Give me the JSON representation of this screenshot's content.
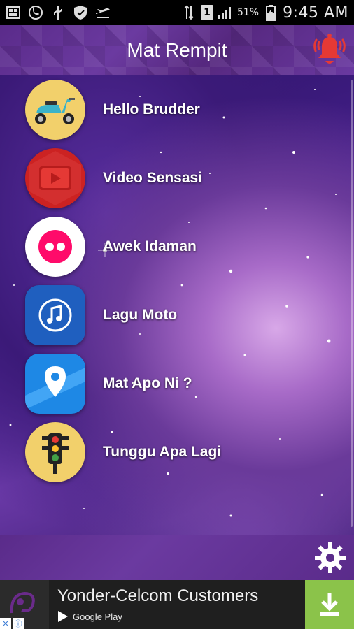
{
  "status_bar": {
    "battery_percent": "51%",
    "time": "9:45 AM",
    "sim_slot": "1",
    "left_icons": [
      "gallery-icon",
      "whatsapp-icon",
      "usb-icon",
      "shield-icon",
      "airplane-icon"
    ]
  },
  "header": {
    "title": "Mat Rempit",
    "bell_icon": "alarm-bell-icon",
    "bell_color": "#e53935"
  },
  "menu": {
    "items": [
      {
        "label": "Hello Brudder",
        "icon": "scooter-icon",
        "bg": "#f2d06b"
      },
      {
        "label": "Video Sensasi",
        "icon": "youtube-icon",
        "bg": "#cc2222"
      },
      {
        "label": "Awek Idaman",
        "icon": "flickr-icon",
        "bg": "#ffffff"
      },
      {
        "label": "Lagu Moto",
        "icon": "music-note-icon",
        "bg": "#1f5fbf"
      },
      {
        "label": "Mat Apo Ni ?",
        "icon": "map-pin-icon",
        "bg": "#1e88e5"
      },
      {
        "label": "Tunggu Apa Lagi",
        "icon": "traffic-light-icon",
        "bg": "#f2d06b"
      }
    ]
  },
  "footer": {
    "settings_icon": "gear-icon"
  },
  "ad": {
    "title": "Yonder-Celcom Customers",
    "store": "Google Play",
    "download_color": "#8bc34a"
  }
}
